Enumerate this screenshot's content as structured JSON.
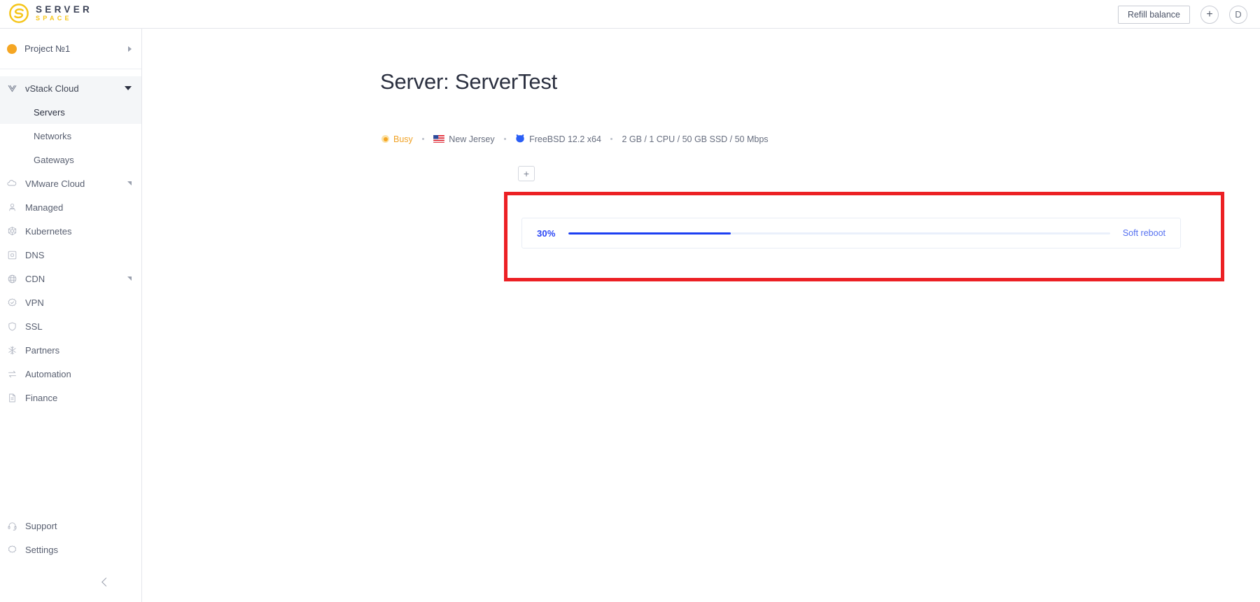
{
  "header": {
    "logo_main": "SERVER",
    "logo_sub": "SPACE",
    "logo_icon": "serverspace-s-logo-icon",
    "refill_label": "Refill balance",
    "add_label": "+",
    "avatar_label": "D"
  },
  "sidebar": {
    "project": {
      "label": "Project №1",
      "icon": "project-dot-icon",
      "expand_icon": "caret-right-icon"
    },
    "groups": [
      {
        "label": "vStack Cloud",
        "icon": "vstack-cloud-icon",
        "expand_icon": "caret-down-icon",
        "expanded": true,
        "items": [
          {
            "label": "Servers",
            "active": true
          },
          {
            "label": "Networks",
            "active": false
          },
          {
            "label": "Gateways",
            "active": false
          }
        ]
      }
    ],
    "items": [
      {
        "label": "VMware Cloud",
        "icon": "cloud-icon",
        "expand_icon": "caret-small-icon"
      },
      {
        "label": "Managed",
        "icon": "managed-person-icon",
        "expand_icon": ""
      },
      {
        "label": "Kubernetes",
        "icon": "kubernetes-helm-icon",
        "expand_icon": ""
      },
      {
        "label": "DNS",
        "icon": "dns-square-icon",
        "expand_icon": ""
      },
      {
        "label": "CDN",
        "icon": "globe-icon",
        "expand_icon": "caret-small-icon"
      },
      {
        "label": "VPN",
        "icon": "vpn-badge-icon",
        "expand_icon": ""
      },
      {
        "label": "SSL",
        "icon": "shield-icon",
        "expand_icon": ""
      },
      {
        "label": "Partners",
        "icon": "partners-asterisk-icon",
        "expand_icon": ""
      },
      {
        "label": "Automation",
        "icon": "automation-arrows-icon",
        "expand_icon": ""
      },
      {
        "label": "Finance",
        "icon": "finance-document-icon",
        "expand_icon": ""
      }
    ],
    "bottom_items": [
      {
        "label": "Support",
        "icon": "headset-icon"
      },
      {
        "label": "Settings",
        "icon": "gear-icon"
      }
    ],
    "collapse_icon": "chevron-left-icon"
  },
  "main": {
    "title": "Server: ServerTest",
    "meta": {
      "status": "Busy",
      "status_icon": "status-dot-busy-icon",
      "status_color": "#f0a226",
      "location": "New Jersey",
      "location_icon": "us-flag-icon",
      "os": "FreeBSD 12.2 x64",
      "os_icon": "freebsd-daemon-icon",
      "specs": "2 GB / 1 CPU / 50 GB SSD / 50 Mbps"
    },
    "add_tab_label": "+",
    "progress": {
      "percent_label": "30%",
      "percent_value": 30,
      "action_label": "Soft reboot",
      "fill_color": "#1d3ff2",
      "track_color": "#eaf0fb",
      "action_color": "#5570f0"
    },
    "highlight_color": "#ec2024"
  }
}
